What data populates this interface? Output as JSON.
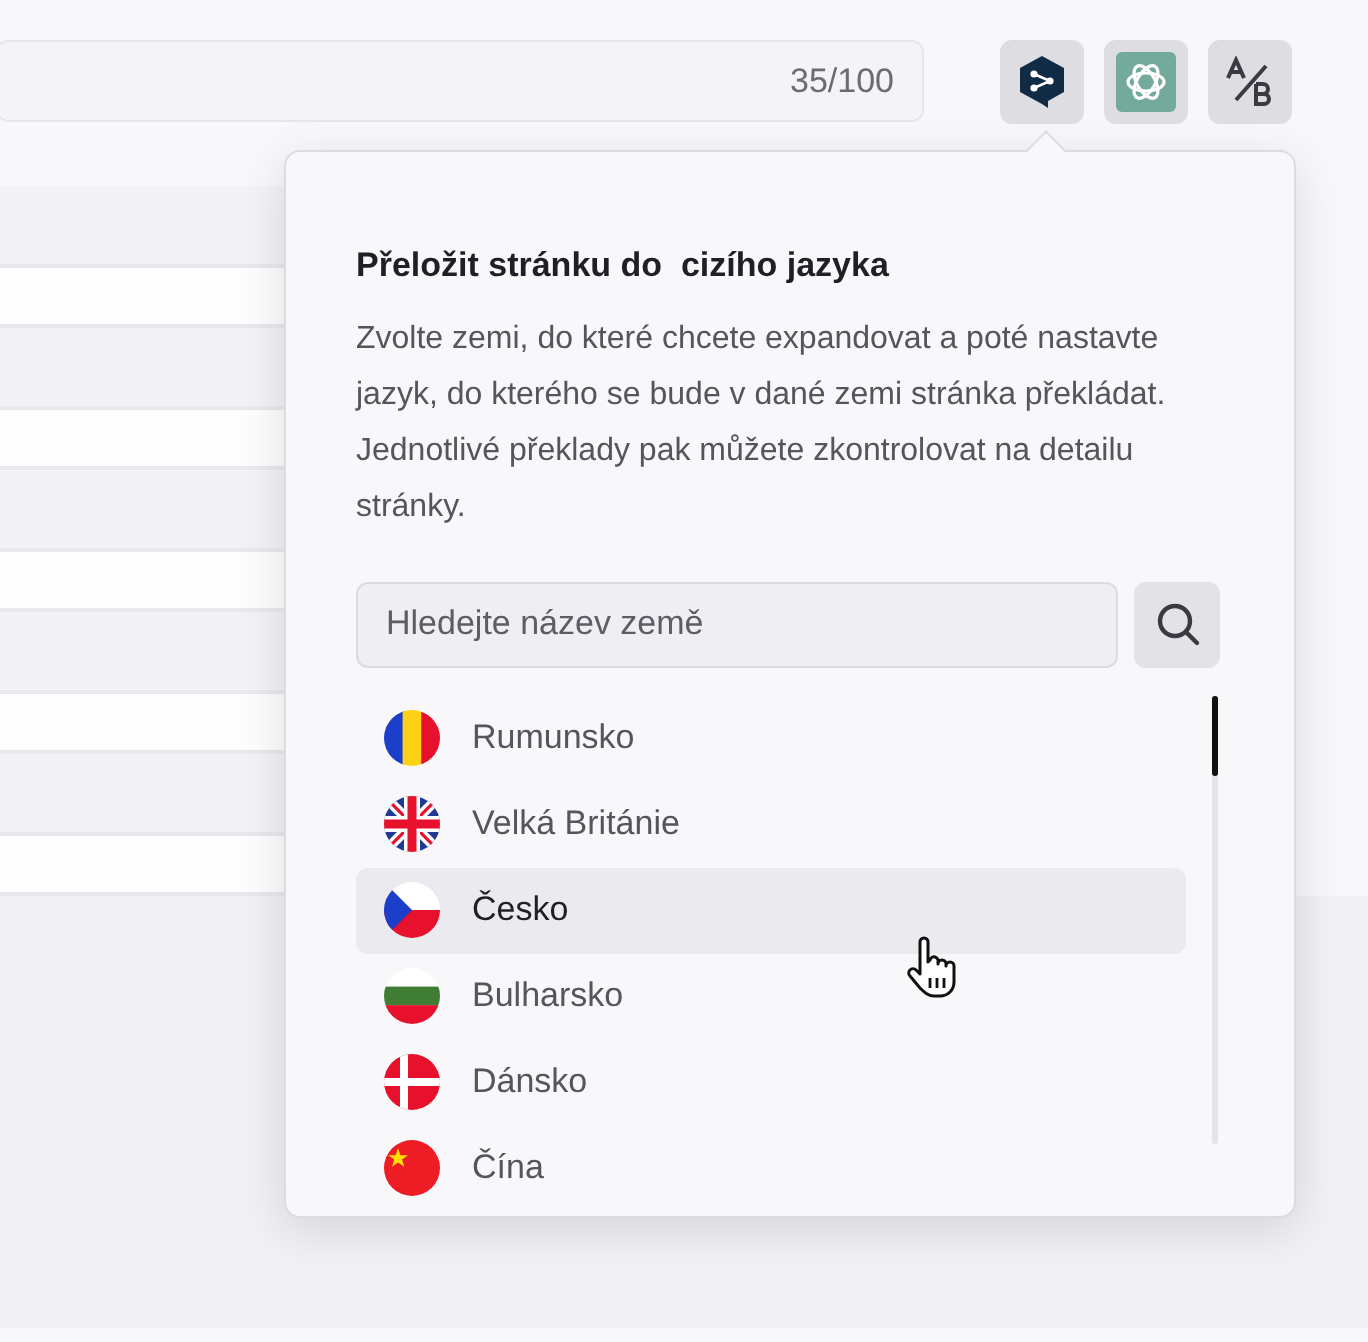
{
  "title_field": {
    "counter": "35/100"
  },
  "toolbar": [
    {
      "kind": "deepl"
    },
    {
      "kind": "chatgpt"
    },
    {
      "kind": "ab"
    }
  ],
  "table": {
    "rows": [
      {
        "shaded": true
      },
      {
        "shaded": false
      },
      {
        "shaded": true
      },
      {
        "shaded": false
      },
      {
        "shaded": true
      },
      {
        "shaded": false
      },
      {
        "shaded": true
      },
      {
        "shaded": false
      },
      {
        "shaded": true
      },
      {
        "shaded": false
      }
    ]
  },
  "popup": {
    "title": "Přeložit stránku do  cizího jazyka",
    "description": "Zvolte zemi, do které chcete expandovat a poté nastavte jazyk, do kterého se bude v dané zemi stránka překládat. Jednotlivé překlady pak můžete zkontrolovat na detailu stránky.",
    "search": {
      "placeholder": "Hledejte název země"
    },
    "countries": [
      {
        "name": "Rumunsko",
        "kind": "romania",
        "selected": false
      },
      {
        "name": "Velká Británie",
        "kind": "uk",
        "selected": false
      },
      {
        "name": "Česko",
        "kind": "czechia",
        "selected": true
      },
      {
        "name": "Bulharsko",
        "kind": "bulgaria",
        "selected": false
      },
      {
        "name": "Dánsko",
        "kind": "denmark",
        "selected": false
      },
      {
        "name": "Čína",
        "kind": "china",
        "selected": false
      }
    ]
  }
}
